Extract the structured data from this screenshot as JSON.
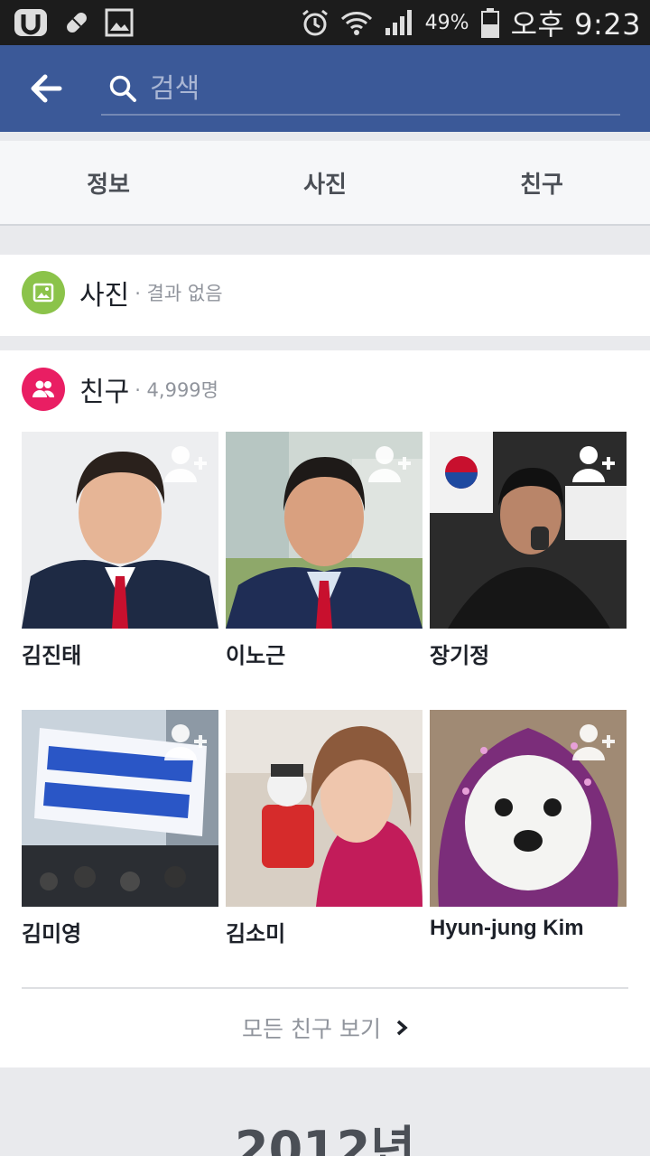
{
  "status_bar": {
    "battery": "49%",
    "clock": "오후 9:23",
    "icons": [
      "u-plus-icon",
      "pill-icon",
      "image-icon",
      "alarm-icon",
      "wifi-icon",
      "signal-icon",
      "battery-icon"
    ]
  },
  "search": {
    "placeholder": "검색"
  },
  "tabs": [
    {
      "label": "정보"
    },
    {
      "label": "사진"
    },
    {
      "label": "친구"
    }
  ],
  "photos_section": {
    "title": "사진",
    "meta": "· 결과 없음"
  },
  "friends_section": {
    "title": "친구",
    "meta": "· 4,999명",
    "friends": [
      {
        "name": "김진태"
      },
      {
        "name": "이노근"
      },
      {
        "name": "장기정"
      },
      {
        "name": "김미영"
      },
      {
        "name": "김소미"
      },
      {
        "name": "Hyun-jung Kim"
      }
    ],
    "see_all": "모든 친구 보기"
  },
  "year_header": "2012년",
  "colors": {
    "brand": "#3b5998",
    "photos_icon": "#8bc34a",
    "friends_icon": "#e91e63"
  }
}
